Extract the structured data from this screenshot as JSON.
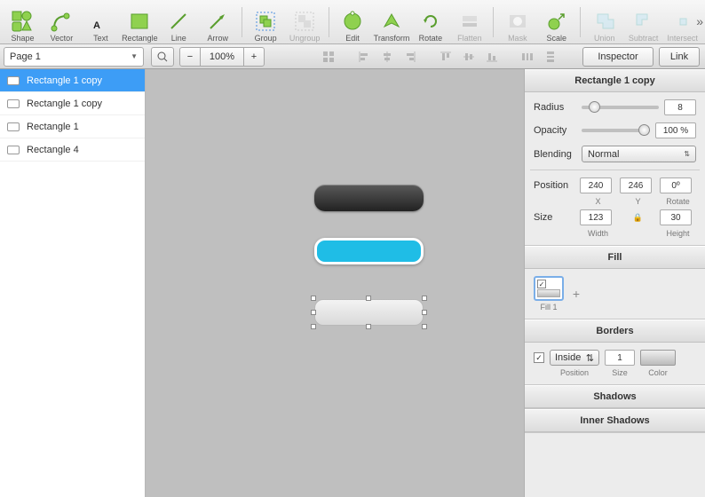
{
  "toolbar": {
    "items": [
      {
        "label": "Shape"
      },
      {
        "label": "Vector"
      },
      {
        "label": "Text"
      },
      {
        "label": "Rectangle"
      },
      {
        "label": "Line"
      },
      {
        "label": "Arrow"
      },
      {
        "label": "Group"
      },
      {
        "label": "Ungroup"
      },
      {
        "label": "Edit"
      },
      {
        "label": "Transform"
      },
      {
        "label": "Rotate"
      },
      {
        "label": "Flatten"
      },
      {
        "label": "Mask"
      },
      {
        "label": "Scale"
      },
      {
        "label": "Union"
      },
      {
        "label": "Subtract"
      },
      {
        "label": "Intersect"
      }
    ]
  },
  "secbar": {
    "page": "Page 1",
    "zoom": "100%",
    "inspector": "Inspector",
    "link": "Link"
  },
  "layers": [
    {
      "name": "Rectangle 1 copy",
      "selected": true
    },
    {
      "name": "Rectangle 1 copy",
      "selected": false
    },
    {
      "name": "Rectangle 1",
      "selected": false
    },
    {
      "name": "Rectangle 4",
      "selected": false
    }
  ],
  "inspector": {
    "title": "Rectangle 1 copy",
    "radius": {
      "label": "Radius",
      "value": "8"
    },
    "opacity": {
      "label": "Opacity",
      "value": "100 %"
    },
    "blending": {
      "label": "Blending",
      "value": "Normal"
    },
    "position": {
      "label": "Position",
      "x": "240",
      "y": "246",
      "rotate": "0º",
      "xlabel": "X",
      "ylabel": "Y",
      "rlabel": "Rotate"
    },
    "size": {
      "label": "Size",
      "w": "123",
      "h": "30",
      "wlabel": "Width",
      "hlabel": "Height"
    },
    "fill": {
      "header": "Fill",
      "item": "Fill 1"
    },
    "borders": {
      "header": "Borders",
      "position": "Inside",
      "size": "1",
      "poslabel": "Position",
      "sizelabel": "Size",
      "colorlabel": "Color"
    },
    "shadows": {
      "header": "Shadows"
    },
    "inner": {
      "header": "Inner Shadows"
    }
  }
}
